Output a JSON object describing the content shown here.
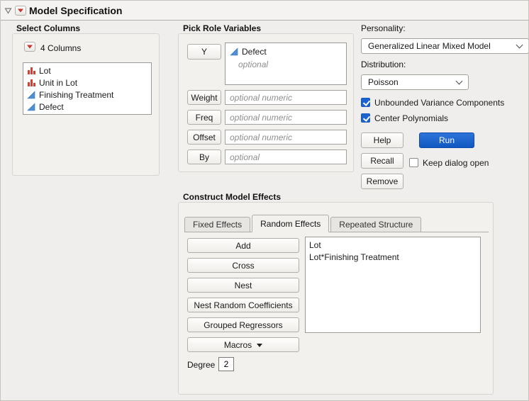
{
  "colors": {
    "accent_blue": "#1661c9",
    "jmp_red": "#c8332d",
    "continuous_blue": "#4e90d5"
  },
  "header": {
    "title": "Model Specification"
  },
  "select_columns": {
    "title": "Select Columns",
    "group_label": "4 Columns",
    "items": [
      {
        "label": "Lot",
        "type": "nominal"
      },
      {
        "label": "Unit in Lot",
        "type": "nominal"
      },
      {
        "label": "Finishing Treatment",
        "type": "continuous"
      },
      {
        "label": "Defect",
        "type": "continuous"
      }
    ]
  },
  "pick_roles": {
    "title": "Pick Role Variables",
    "y_button": "Y",
    "y_value": "Defect",
    "y_placeholder": "optional",
    "rows": [
      {
        "button": "Weight",
        "placeholder": "optional numeric"
      },
      {
        "button": "Freq",
        "placeholder": "optional numeric"
      },
      {
        "button": "Offset",
        "placeholder": "optional numeric"
      },
      {
        "button": "By",
        "placeholder": "optional"
      }
    ]
  },
  "personality": {
    "label": "Personality:",
    "value": "Generalized Linear Mixed Model",
    "distribution_label": "Distribution:",
    "distribution_value": "Poisson",
    "checkboxes": [
      {
        "label": "Unbounded Variance Components",
        "checked": true
      },
      {
        "label": "Center Polynomials",
        "checked": true
      }
    ],
    "help": "Help",
    "run": "Run",
    "recall": "Recall",
    "remove": "Remove",
    "keep_dialog": {
      "label": "Keep dialog open",
      "checked": false
    }
  },
  "model_effects": {
    "title": "Construct Model Effects",
    "tabs": [
      {
        "label": "Fixed Effects",
        "active": false
      },
      {
        "label": "Random Effects",
        "active": true
      },
      {
        "label": "Repeated Structure",
        "active": false
      }
    ],
    "buttons": [
      "Add",
      "Cross",
      "Nest",
      "Nest Random Coefficients",
      "Grouped Regressors"
    ],
    "macros_label": "Macros",
    "degree_label": "Degree",
    "degree_value": "2",
    "effects": [
      "Lot",
      "Lot*Finishing Treatment"
    ]
  }
}
